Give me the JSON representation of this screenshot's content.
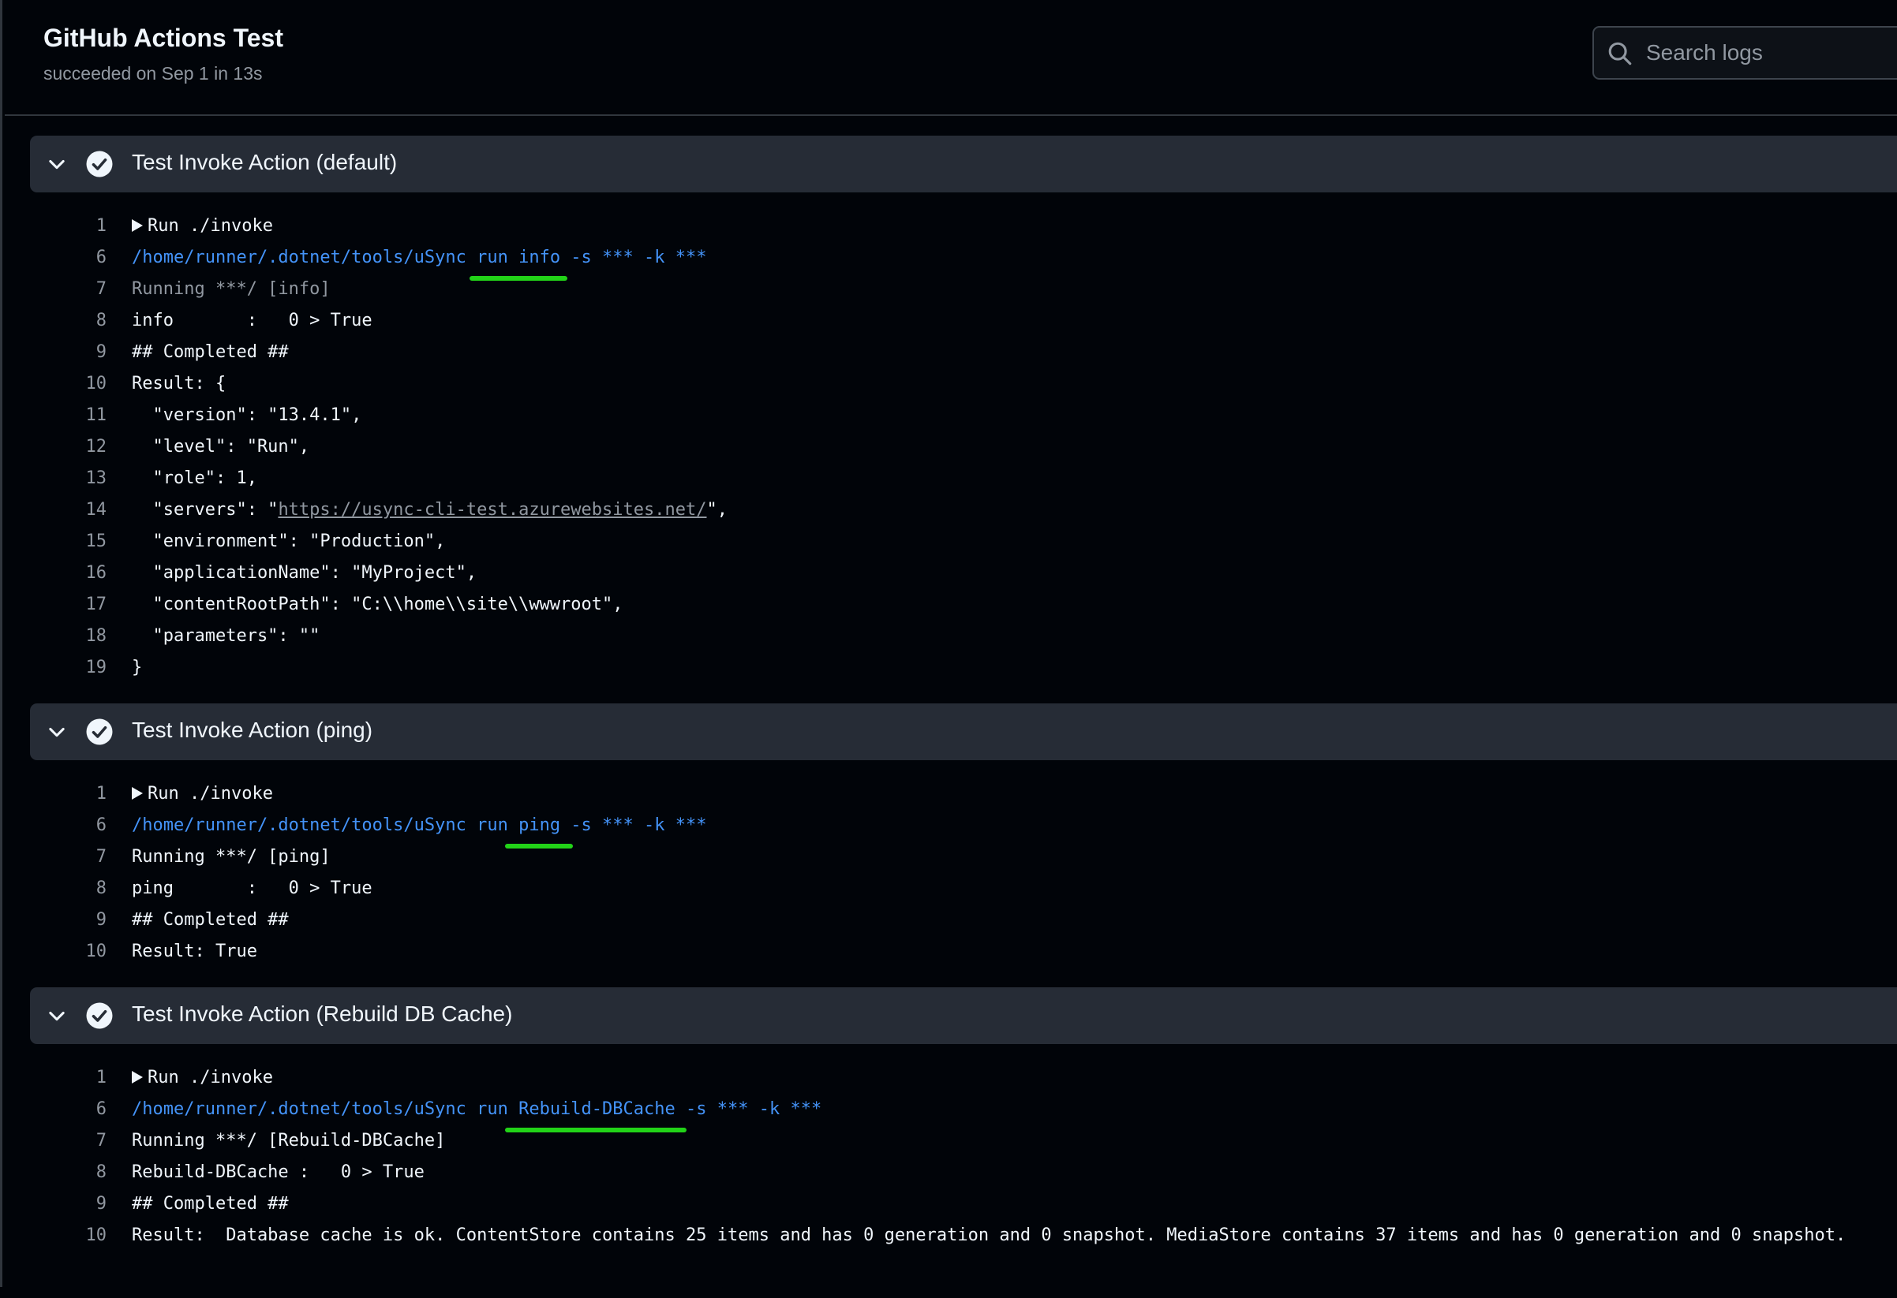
{
  "header": {
    "title": "GitHub Actions Test",
    "status": "succeeded on Sep 1 in 13s",
    "search_placeholder": "Search logs"
  },
  "sections": [
    {
      "title": "Test Invoke Action (default)",
      "lines": [
        {
          "n": "1",
          "text": "Run ./invoke"
        },
        {
          "n": "6",
          "path": "/home/runner/.dotnet/tools/uSync run ",
          "arg": "info",
          "rest": " -s *** -k ***"
        },
        {
          "n": "7",
          "text": "Running ***/ [info]"
        },
        {
          "n": "8",
          "text": "info       :   0 > True"
        },
        {
          "n": "9",
          "text": "## Completed ##"
        },
        {
          "n": "10",
          "text": "Result: {"
        },
        {
          "n": "11",
          "text": "  \"version\": \"13.4.1\","
        },
        {
          "n": "12",
          "text": "  \"level\": \"Run\","
        },
        {
          "n": "13",
          "text": "  \"role\": 1,"
        },
        {
          "n": "14",
          "pre": "  \"servers\": \"",
          "url": "https://usync-cli-test.azurewebsites.net/",
          "post": "\","
        },
        {
          "n": "15",
          "text": "  \"environment\": \"Production\","
        },
        {
          "n": "16",
          "text": "  \"applicationName\": \"MyProject\","
        },
        {
          "n": "17",
          "text": "  \"contentRootPath\": \"C:\\\\home\\\\site\\\\wwwroot\","
        },
        {
          "n": "18",
          "text": "  \"parameters\": \"\""
        },
        {
          "n": "19",
          "text": "}"
        }
      ]
    },
    {
      "title": "Test Invoke Action (ping)",
      "lines": [
        {
          "n": "1",
          "text": "Run ./invoke"
        },
        {
          "n": "6",
          "path": "/home/runner/.dotnet/tools/uSync run ",
          "arg": "ping",
          "rest": " -s *** -k ***"
        },
        {
          "n": "7",
          "text": "Running ***/ [ping]"
        },
        {
          "n": "8",
          "text": "ping       :   0 > True"
        },
        {
          "n": "9",
          "text": "## Completed ##"
        },
        {
          "n": "10",
          "text": "Result: True"
        }
      ]
    },
    {
      "title": "Test Invoke Action (Rebuild DB Cache)",
      "lines": [
        {
          "n": "1",
          "text": "Run ./invoke"
        },
        {
          "n": "6",
          "path": "/home/runner/.dotnet/tools/uSync run ",
          "arg": "Rebuild-DBCache",
          "rest": " -s *** -k ***"
        },
        {
          "n": "7",
          "text": "Running ***/ [Rebuild-DBCache]"
        },
        {
          "n": "8",
          "text": "Rebuild-DBCache :   0 > True"
        },
        {
          "n": "9",
          "text": "## Completed ##"
        },
        {
          "n": "10",
          "text": "Result:  Database cache is ok. ContentStore contains 25 items and has 0 generation and 0 snapshot. MediaStore contains 37 items and has 0 generation and 0 snapshot."
        }
      ]
    }
  ],
  "colors": {
    "background": "#010409",
    "section_header": "#262c36",
    "command": "#4493f8",
    "annotation": "#22d318"
  }
}
